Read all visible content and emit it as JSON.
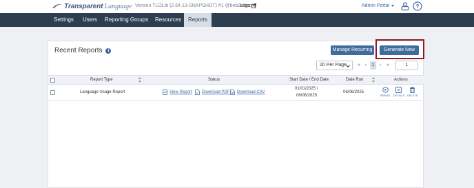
{
  "header": {
    "logo_bold": "Transparent",
    "logo_light": "Language",
    "version": "Version TLOLib (2.64.13-SNAPSHOT) #1 @beb2e0ec4c",
    "logs_label": "Logs",
    "admin_portal": "Admin Portal",
    "icons": [
      "user-icon",
      "help-icon"
    ]
  },
  "nav": {
    "items": [
      {
        "label": "Settings"
      },
      {
        "label": "Users"
      },
      {
        "label": "Reporting Groups"
      },
      {
        "label": "Resources"
      },
      {
        "label": "Reports"
      }
    ],
    "active": "Reports"
  },
  "reports": {
    "title": "Recent Reports",
    "manage_recurring": "Manage Recurring",
    "generate_new": "Generate New",
    "per_page": "20 Per Page",
    "pagination": {
      "first": "«",
      "prev": "‹",
      "current": "1",
      "next": "›",
      "last": "»"
    },
    "page_input": "1",
    "columns": {
      "report_type": "Report Type",
      "status": "Status",
      "dates": "Start Date / End Date",
      "date_run": "Date Run",
      "actions": "Actions"
    },
    "rows": [
      {
        "report_type": "Language Usage Report",
        "view_report": "View Report",
        "download_pdf": "Download PDF",
        "download_csv": "Download CSV",
        "start_date": "01/01/2025 /",
        "end_date": "06/06/2025",
        "date_run": "06/06/2025",
        "actions": {
          "rerun": "RERUN",
          "details": "DETAILS",
          "delete": "DELETE"
        }
      }
    ]
  },
  "colors": {
    "nav_bg": "#2c3e50",
    "button_bg": "#3f6c9c",
    "highlight": "#8b1a2b",
    "link": "#3d6aa3"
  }
}
